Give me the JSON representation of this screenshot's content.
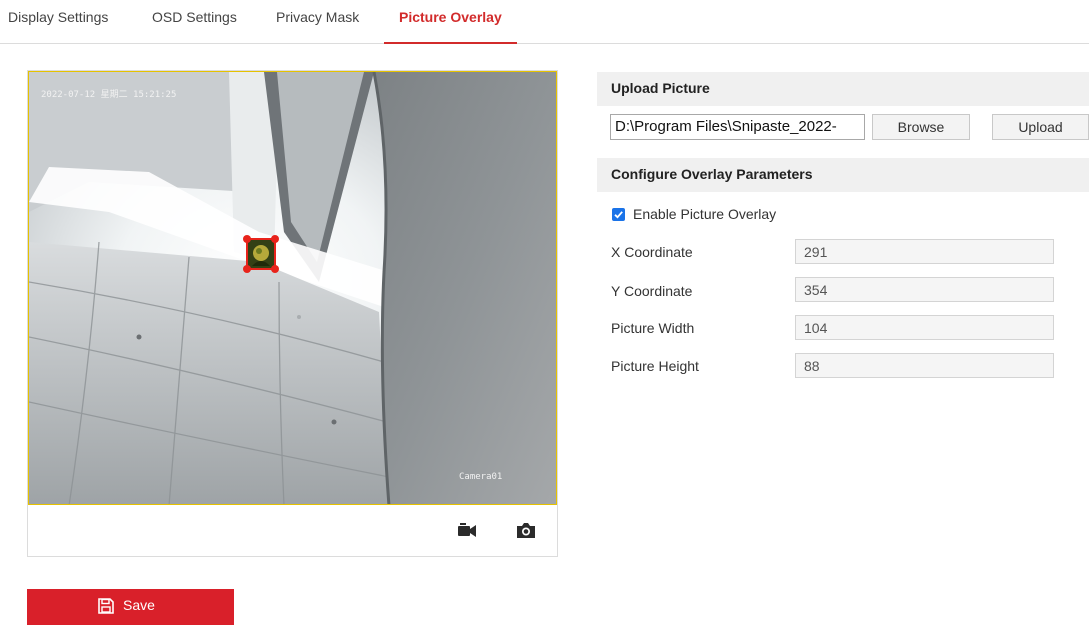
{
  "tabs": [
    {
      "label": "Display Settings",
      "active": false
    },
    {
      "label": "OSD Settings",
      "active": false
    },
    {
      "label": "Privacy Mask",
      "active": false
    },
    {
      "label": "Picture Overlay",
      "active": true
    }
  ],
  "preview": {
    "osd_time": "2022-07-12 星期二 15:21:25",
    "osd_camera": "Camera01",
    "toolbar_icons": [
      "record-icon",
      "snapshot-icon"
    ]
  },
  "upload": {
    "title": "Upload Picture",
    "file_path": "D:\\Program Files\\Snipaste_2022-",
    "browse_label": "Browse",
    "upload_label": "Upload"
  },
  "overlay": {
    "title": "Configure Overlay Parameters",
    "enable_label": "Enable Picture Overlay",
    "enabled": true,
    "fields": [
      {
        "label": "X Coordinate",
        "value": "291"
      },
      {
        "label": "Y Coordinate",
        "value": "354"
      },
      {
        "label": "Picture Width",
        "value": "104"
      },
      {
        "label": "Picture Height",
        "value": "88"
      }
    ]
  },
  "save": {
    "label": "Save",
    "icon": "floppy-disk-icon"
  },
  "colors": {
    "accent": "#d22b2b",
    "save_button": "#d9202a",
    "checkbox": "#1a73e8",
    "section_header_bg": "#f0f0f0",
    "preview_border": "#e6c200"
  }
}
